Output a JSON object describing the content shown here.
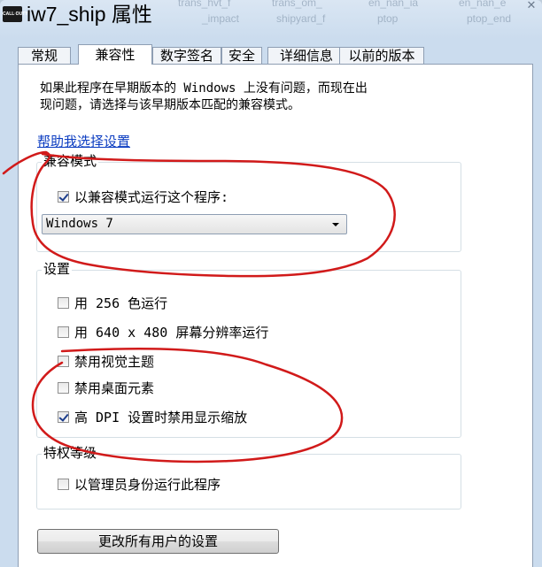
{
  "window": {
    "title": "iw7_ship 属性",
    "icon_text": "CALL·DUTY",
    "close_symbol": "✕",
    "background_text": [
      "trans_hvt_f",
      "trans_om_",
      "en_nan_ia",
      "en_nan_e",
      "_impact",
      "shipyard_f",
      "ptop",
      "ptop_end"
    ]
  },
  "tabs": [
    {
      "label": "常规"
    },
    {
      "label": "兼容性",
      "active": true
    },
    {
      "label": "数字签名"
    },
    {
      "label": "安全"
    },
    {
      "label": "详细信息"
    },
    {
      "label": "以前的版本"
    }
  ],
  "intro": {
    "line1": "如果此程序在早期版本的 Windows 上没有问题，而现在出",
    "line2": "现问题，请选择与该早期版本匹配的兼容模式。"
  },
  "help_link": "帮助我选择设置",
  "compat_group": {
    "title": "兼容模式",
    "checkbox_label": "以兼容模式运行这个程序:",
    "checked": true,
    "select_value": "Windows 7"
  },
  "settings_group": {
    "title": "设置",
    "options": [
      {
        "label": "用 256 色运行",
        "checked": false
      },
      {
        "label": "用 640 x 480 屏幕分辨率运行",
        "checked": false
      },
      {
        "label": "禁用视觉主题",
        "checked": false
      },
      {
        "label": "禁用桌面元素",
        "checked": false
      },
      {
        "label": "高 DPI 设置时禁用显示缩放",
        "checked": true
      }
    ]
  },
  "privilege_group": {
    "title": "特权等级",
    "option": {
      "label": "以管理员身份运行此程序",
      "checked": false
    }
  },
  "change_all_button": "更改所有用户的设置",
  "colors": {
    "annotation": "#d11a1a",
    "link": "#0b3cc1",
    "title_bar": "#cbdcee"
  }
}
